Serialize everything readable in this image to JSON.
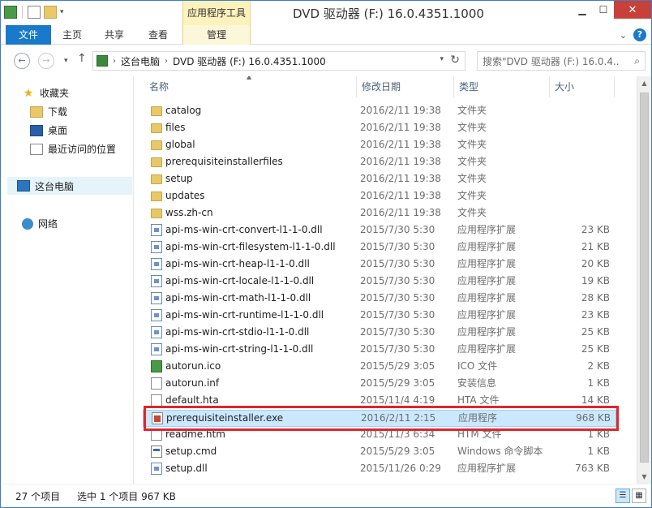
{
  "window": {
    "title": "DVD 驱动器 (F:) 16.0.4351.1000",
    "context_tab_title": "应用程序工具"
  },
  "ribbon": {
    "tabs": [
      "文件",
      "主页",
      "共享",
      "查看",
      "管理"
    ]
  },
  "address": {
    "back_label": "←",
    "forward_label": "→",
    "up_label": "↑",
    "segments": [
      "这台电脑",
      "DVD 驱动器 (F:) 16.0.4351.1000"
    ],
    "search_placeholder": "搜索\"DVD 驱动器 (F:) 16.0.4..."
  },
  "nav": {
    "favorites": "收藏夹",
    "downloads": "下载",
    "desktop": "桌面",
    "recent": "最近访问的位置",
    "this_pc": "这台电脑",
    "network": "网络"
  },
  "columns": {
    "name": "名称",
    "date": "修改日期",
    "type": "类型",
    "size": "大小"
  },
  "files": [
    {
      "name": "catalog",
      "date": "2016/2/11 19:38",
      "type": "文件夹",
      "size": "",
      "icon": "folder-icon"
    },
    {
      "name": "files",
      "date": "2016/2/11 19:38",
      "type": "文件夹",
      "size": "",
      "icon": "folder-icon"
    },
    {
      "name": "global",
      "date": "2016/2/11 19:38",
      "type": "文件夹",
      "size": "",
      "icon": "folder-icon"
    },
    {
      "name": "prerequisiteinstallerfiles",
      "date": "2016/2/11 19:38",
      "type": "文件夹",
      "size": "",
      "icon": "folder-icon"
    },
    {
      "name": "setup",
      "date": "2016/2/11 19:38",
      "type": "文件夹",
      "size": "",
      "icon": "folder-icon"
    },
    {
      "name": "updates",
      "date": "2016/2/11 19:38",
      "type": "文件夹",
      "size": "",
      "icon": "folder-icon"
    },
    {
      "name": "wss.zh-cn",
      "date": "2016/2/11 19:38",
      "type": "文件夹",
      "size": "",
      "icon": "folder-icon"
    },
    {
      "name": "api-ms-win-crt-convert-l1-1-0.dll",
      "date": "2015/7/30 5:30",
      "type": "应用程序扩展",
      "size": "23 KB",
      "icon": "dll-icon"
    },
    {
      "name": "api-ms-win-crt-filesystem-l1-1-0.dll",
      "date": "2015/7/30 5:30",
      "type": "应用程序扩展",
      "size": "21 KB",
      "icon": "dll-icon"
    },
    {
      "name": "api-ms-win-crt-heap-l1-1-0.dll",
      "date": "2015/7/30 5:30",
      "type": "应用程序扩展",
      "size": "20 KB",
      "icon": "dll-icon"
    },
    {
      "name": "api-ms-win-crt-locale-l1-1-0.dll",
      "date": "2015/7/30 5:30",
      "type": "应用程序扩展",
      "size": "19 KB",
      "icon": "dll-icon"
    },
    {
      "name": "api-ms-win-crt-math-l1-1-0.dll",
      "date": "2015/7/30 5:30",
      "type": "应用程序扩展",
      "size": "28 KB",
      "icon": "dll-icon"
    },
    {
      "name": "api-ms-win-crt-runtime-l1-1-0.dll",
      "date": "2015/7/30 5:30",
      "type": "应用程序扩展",
      "size": "23 KB",
      "icon": "dll-icon"
    },
    {
      "name": "api-ms-win-crt-stdio-l1-1-0.dll",
      "date": "2015/7/30 5:30",
      "type": "应用程序扩展",
      "size": "25 KB",
      "icon": "dll-icon"
    },
    {
      "name": "api-ms-win-crt-string-l1-1-0.dll",
      "date": "2015/7/30 5:30",
      "type": "应用程序扩展",
      "size": "25 KB",
      "icon": "dll-icon"
    },
    {
      "name": "autorun.ico",
      "date": "2015/5/29 3:05",
      "type": "ICO 文件",
      "size": "2 KB",
      "icon": "image-icon"
    },
    {
      "name": "autorun.inf",
      "date": "2015/5/29 3:05",
      "type": "安装信息",
      "size": "1 KB",
      "icon": "settings-file-icon"
    },
    {
      "name": "default.hta",
      "date": "2015/11/4 4:19",
      "type": "HTA 文件",
      "size": "14 KB",
      "icon": "document-icon"
    },
    {
      "name": "prerequisiteinstaller.exe",
      "date": "2016/2/11 2:15",
      "type": "应用程序",
      "size": "968 KB",
      "icon": "exe-icon",
      "selected": true
    },
    {
      "name": "readme.htm",
      "date": "2015/11/3 6:34",
      "type": "HTM 文件",
      "size": "1 KB",
      "icon": "document-icon"
    },
    {
      "name": "setup.cmd",
      "date": "2015/5/29 3:05",
      "type": "Windows 命令脚本",
      "size": "1 KB",
      "icon": "script-icon"
    },
    {
      "name": "setup.dll",
      "date": "2015/11/26 0:29",
      "type": "应用程序扩展",
      "size": "763 KB",
      "icon": "dll-icon"
    }
  ],
  "status": {
    "item_count": "27 个项目",
    "selection": "选中 1 个项目  967 KB"
  }
}
